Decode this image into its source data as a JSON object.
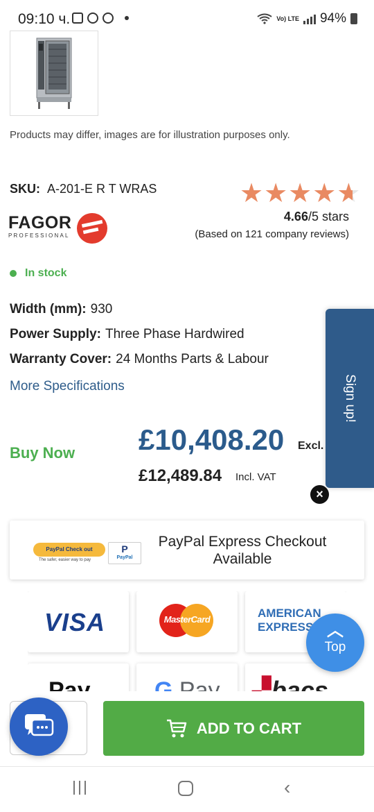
{
  "status_bar": {
    "time": "09:10 ч.",
    "battery": "94%",
    "network": "Vo) LTE"
  },
  "product": {
    "disclaimer": "Products may differ, images are for illustration purposes only.",
    "sku_label": "SKU:",
    "sku_value": "A-201-E R T WRAS",
    "brand_name": "FAGOR",
    "brand_sub": "PROFESSIONAL",
    "rating_value": "4.66",
    "rating_suffix": "/5 stars",
    "rating_fraction": 0.932,
    "reviews": "(Based on 121 company reviews)",
    "stock": "In stock",
    "specs": [
      {
        "label": "Width (mm):",
        "value": "930"
      },
      {
        "label": "Power Supply:",
        "value": "Three Phase Hardwired"
      },
      {
        "label": "Warranty Cover:",
        "value": "24 Months Parts & Labour"
      }
    ],
    "more_specs": "More Specifications",
    "buy_now": "Buy Now",
    "price_excl": "£10,408.20",
    "excl_label": "Excl. VAT",
    "price_incl": "£12,489.84",
    "incl_label": "Incl. VAT"
  },
  "signup": {
    "label": "Sign up!",
    "close": "×"
  },
  "paypal": {
    "checkout_badge": "PayPal Check out",
    "tagline": "The safer, easier way to pay",
    "logo_text": "PayPal",
    "text": "PayPal Express Checkout Available"
  },
  "payment_methods": {
    "visa": "VISA",
    "mastercard": "MasterCard",
    "amex_line1": "AMERICAN",
    "amex_line2": "EXPRESS",
    "apple_pay": "Pay",
    "google_pay": "Pay",
    "bacs": "bacs"
  },
  "top_button": {
    "label": "Top"
  },
  "cart": {
    "add_label": "ADD TO CART"
  },
  "colors": {
    "accent_blue": "#2b5b8c",
    "green": "#52ab46",
    "star": "#e98a62",
    "signup_bg": "#2f5b8a",
    "top_button": "#3f8fe6",
    "chat_button": "#2d62c4"
  }
}
